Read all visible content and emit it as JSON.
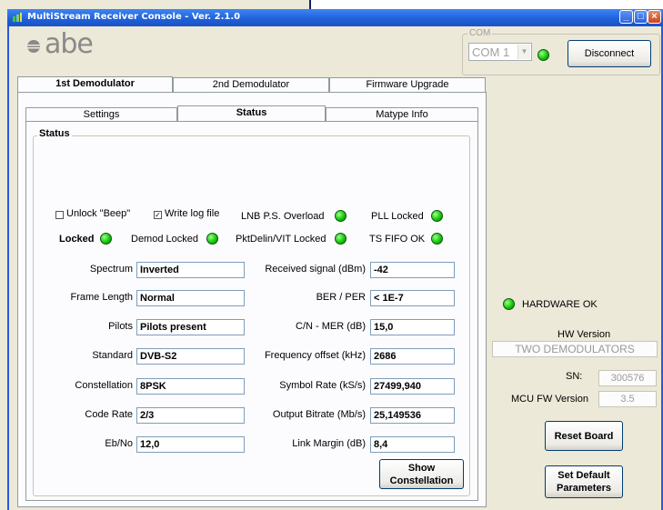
{
  "window": {
    "title": "MultiStream Receiver Console - Ver. 2.1.0"
  },
  "logo": {
    "text": "abe"
  },
  "com": {
    "legend": "COM",
    "port": "COM 1",
    "disconnect_label": "Disconnect"
  },
  "main_tabs": [
    {
      "label": "1st Demodulator",
      "active": true
    },
    {
      "label": "2nd Demodulator",
      "active": false
    },
    {
      "label": "Firmware Upgrade",
      "active": false
    }
  ],
  "sub_tabs": [
    {
      "label": "Settings",
      "active": false
    },
    {
      "label": "Status",
      "active": true
    },
    {
      "label": "Matype Info",
      "active": false
    }
  ],
  "status": {
    "legend": "Status",
    "unlock_beep": {
      "label": "Unlock \"Beep\"",
      "checked": false
    },
    "write_log": {
      "label": "Write log file",
      "checked": true
    },
    "indicators": [
      {
        "label": "LNB P.S. Overload"
      },
      {
        "label": "PLL Locked"
      },
      {
        "label": "Locked"
      },
      {
        "label": "Demod Locked"
      },
      {
        "label": "PktDelin/VIT Locked"
      },
      {
        "label": "TS FIFO OK"
      }
    ],
    "left_fields": [
      {
        "label": "Spectrum",
        "value": "Inverted"
      },
      {
        "label": "Frame Length",
        "value": "Normal"
      },
      {
        "label": "Pilots",
        "value": "Pilots present"
      },
      {
        "label": "Standard",
        "value": "DVB-S2"
      },
      {
        "label": "Constellation",
        "value": "8PSK"
      },
      {
        "label": "Code Rate",
        "value": "2/3"
      },
      {
        "label": "Eb/No",
        "value": "12,0"
      }
    ],
    "right_fields": [
      {
        "label": "Received signal (dBm)",
        "value": "-42"
      },
      {
        "label": "BER / PER",
        "value": "< 1E-7"
      },
      {
        "label": "C/N - MER (dB)",
        "value": "15,0"
      },
      {
        "label": "Frequency offset (kHz)",
        "value": "2686"
      },
      {
        "label": "Symbol Rate (kS/s)",
        "value": "27499,940"
      },
      {
        "label": "Output Bitrate (Mb/s)",
        "value": "25,149536"
      },
      {
        "label": "Link Margin (dB)",
        "value": "8,4"
      }
    ],
    "show_constellation_line1": "Show",
    "show_constellation_line2": "Constellation"
  },
  "hardware": {
    "status_label": "HARDWARE OK",
    "hw_version_label": "HW Version",
    "hw_version_value": "TWO DEMODULATORS",
    "sn_label": "SN:",
    "sn_value": "300576",
    "mcu_label": "MCU FW Version",
    "mcu_value": "3.5",
    "reset_label": "Reset Board",
    "set_default_line1": "Set Default",
    "set_default_line2": "Parameters"
  },
  "colors": {
    "titlebar": "#1f5fd8",
    "led_green": "#17c40e",
    "window_bg": "#ece9d8"
  }
}
